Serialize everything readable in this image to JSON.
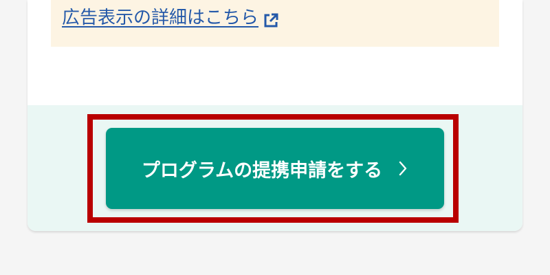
{
  "notice": {
    "link_text": "広告表示の詳細はこちら",
    "link_icon": "external-link-icon",
    "background": "#fdf4e3",
    "link_color": "#2459a9"
  },
  "action": {
    "button_label": "プログラムの提携申請をする",
    "button_icon": "chevron-right-icon",
    "button_color": "#009985",
    "highlight_color": "#b90000",
    "footer_background": "#eaf7f4"
  }
}
